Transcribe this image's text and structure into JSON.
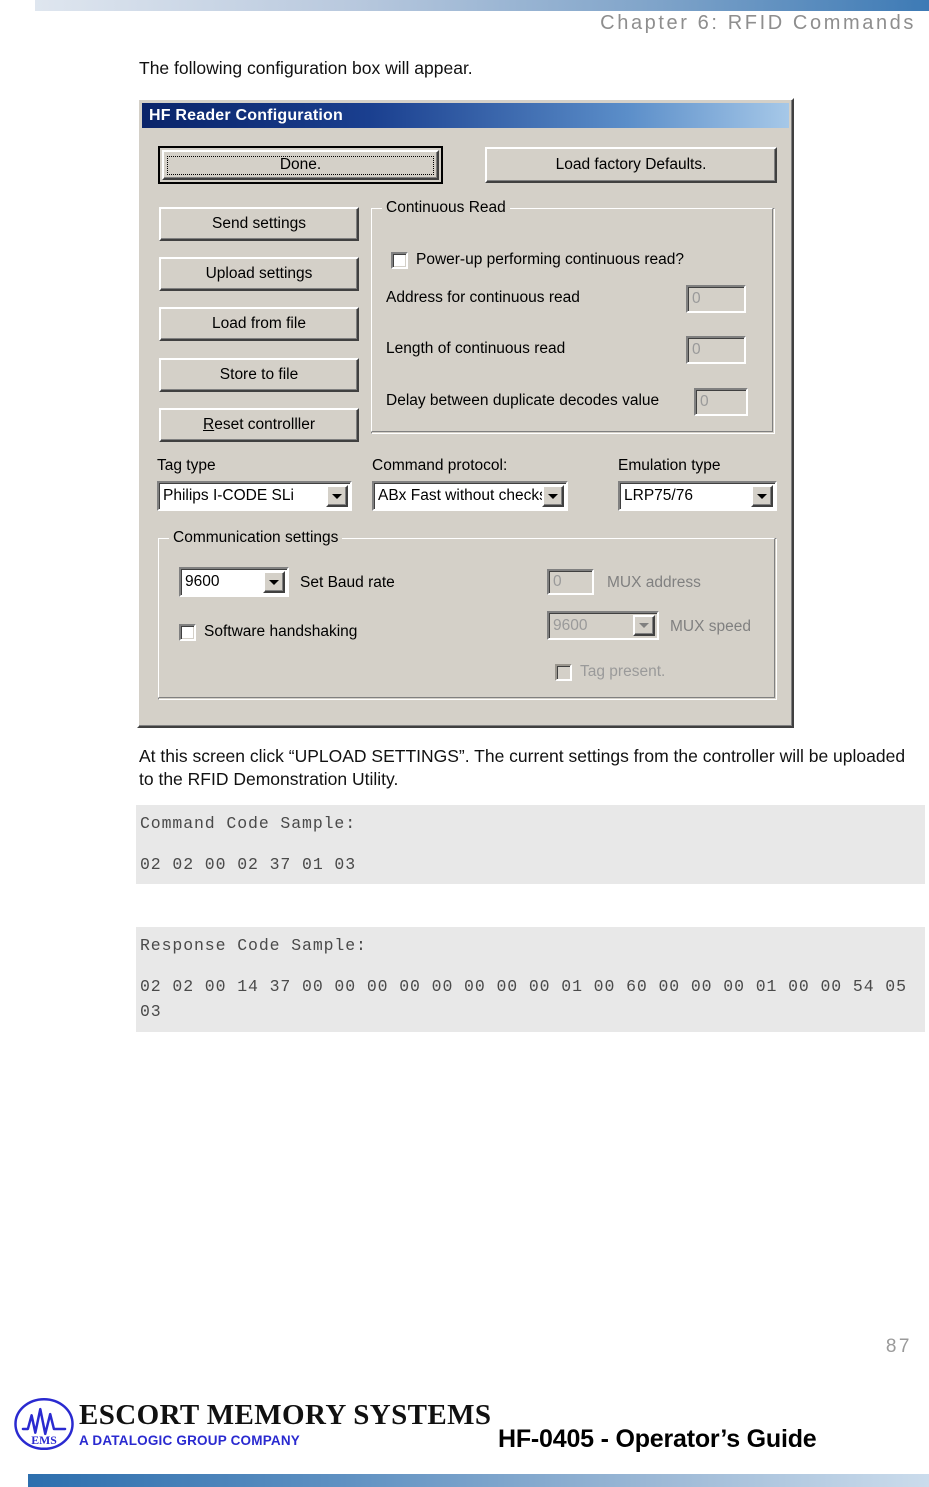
{
  "page": {
    "chapter_header": "Chapter 6: RFID Commands",
    "intro_text": "The following configuration box will appear.",
    "after_text": "At this screen click “UPLOAD SETTINGS”. The current settings from the controller will be uploaded to the RFID Demonstration Utility.",
    "page_number": "87"
  },
  "code_samples": {
    "command": {
      "label": "Command Code Sample:",
      "value": "02 02 00 02 37 01 03"
    },
    "response": {
      "label": "Response Code Sample:",
      "value": "02 02 00 14 37 00 00 00 00 00 00 00 00 01 00 60 00 00 00 01 00 00 54 05 03"
    }
  },
  "dialog": {
    "title": "HF Reader Configuration",
    "buttons": {
      "done": "Done.",
      "load_factory_defaults": "Load factory Defaults.",
      "send_settings": "Send settings",
      "upload_settings": "Upload settings",
      "load_from_file": "Load from file",
      "store_to_file": "Store to file",
      "reset_controller_accel": "R",
      "reset_controller_rest": "eset controlller"
    },
    "continuous_read": {
      "group_title": "Continuous Read",
      "powerup_checkbox_label": "Power-up performing continuous read?",
      "powerup_checked": false,
      "address_label": "Address for continuous read",
      "address_value": "0",
      "length_label": "Length of continuous read",
      "length_value": "0",
      "delay_label": "Delay between duplicate decodes value",
      "delay_value": "0"
    },
    "selectors": {
      "tag_type_label": "Tag type",
      "tag_type_value": "Philips I-CODE SLi",
      "command_protocol_label": "Command protocol:",
      "command_protocol_value": "ABx Fast without checksum",
      "emulation_type_label": "Emulation type",
      "emulation_type_value": "LRP75/76"
    },
    "communication": {
      "group_title": "Communication settings",
      "baud_value": "9600",
      "baud_label": "Set Baud rate",
      "software_handshaking_label": "Software handshaking",
      "software_handshaking_checked": false,
      "mux_address_value": "0",
      "mux_address_label": "MUX address",
      "mux_speed_value": "9600",
      "mux_speed_label": "MUX speed",
      "tag_present_label": "Tag present.",
      "tag_present_checked": false
    }
  },
  "footer": {
    "logo_mark": "EMS",
    "company_name": "ESCORT MEMORY SYSTEMS",
    "company_tagline": "A DATALOGIC GROUP COMPANY",
    "guide_title": "HF-0405 - Operator’s Guide"
  },
  "colors": {
    "header_accent": "#3d7ab5",
    "titlebar_start": "#0a246a",
    "dialog_face": "#d4d0c8",
    "code_bg": "#e8e8e8",
    "logo_blue": "#2a2ad0"
  }
}
